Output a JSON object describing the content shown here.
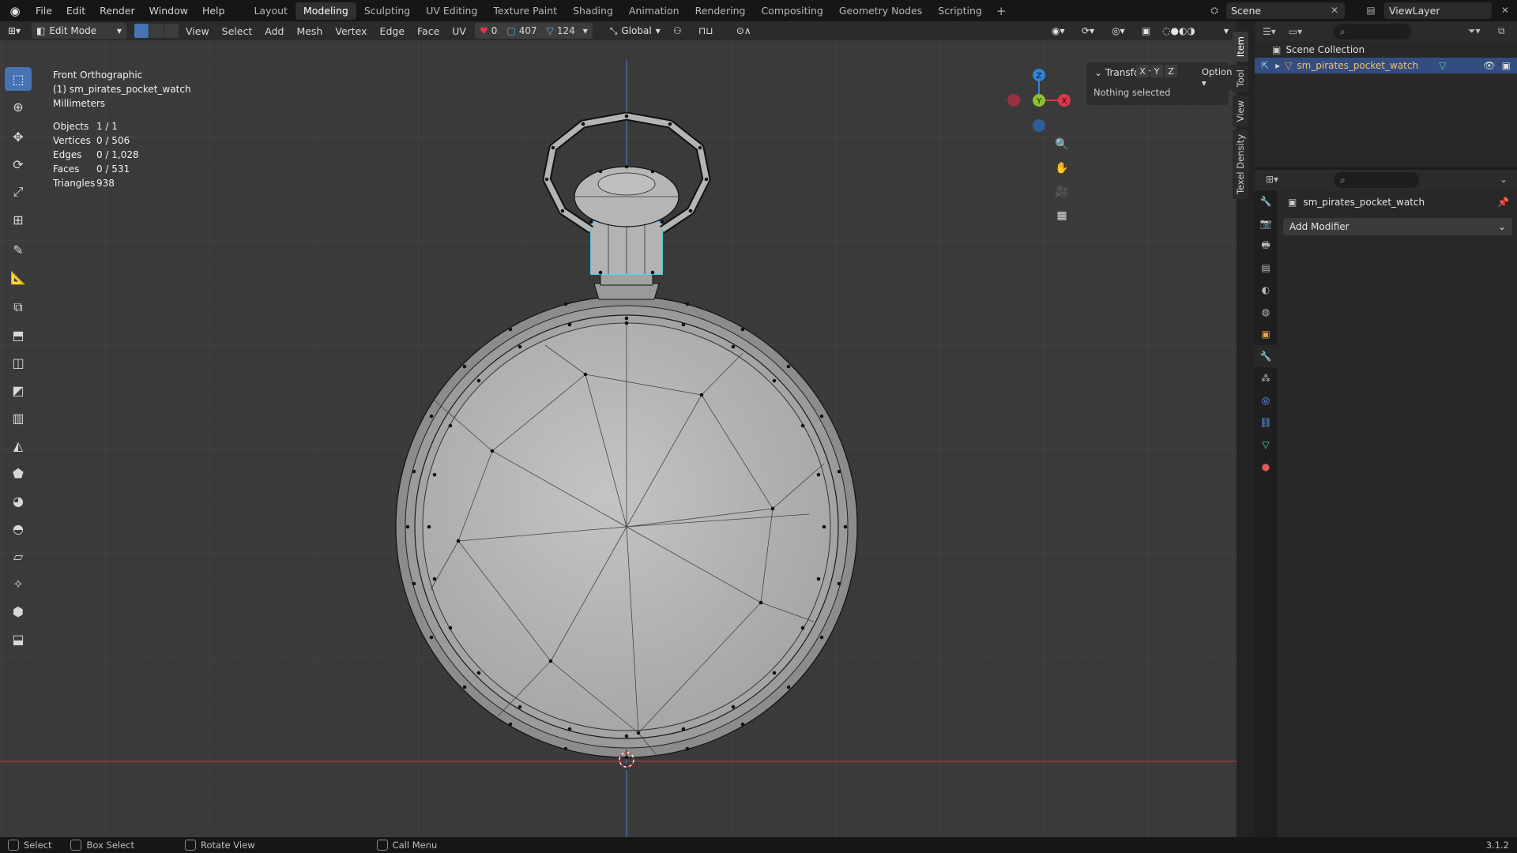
{
  "app": {
    "menus": [
      "File",
      "Edit",
      "Render",
      "Window",
      "Help"
    ],
    "workspaces": [
      "Layout",
      "Modeling",
      "Sculpting",
      "UV Editing",
      "Texture Paint",
      "Shading",
      "Animation",
      "Rendering",
      "Compositing",
      "Geometry Nodes",
      "Scripting"
    ],
    "active_workspace": "Modeling",
    "scene": "Scene",
    "view_layer": "ViewLayer",
    "version": "3.1.2"
  },
  "viewport_header": {
    "mode": "Edit Mode",
    "menus": [
      "View",
      "Select",
      "Add",
      "Mesh",
      "Vertex",
      "Edge",
      "Face",
      "UV"
    ],
    "stat_a": "0",
    "stat_b": "407",
    "stat_c": "124",
    "orientation": "Global",
    "options_label": "Options",
    "axis_x": "X",
    "axis_y": "Y",
    "axis_z": "Z"
  },
  "overlay": {
    "view_name": "Front Orthographic",
    "object_label": "(1) sm_pirates_pocket_watch",
    "units": "Millimeters",
    "stats": [
      {
        "k": "Objects",
        "v": "1 / 1"
      },
      {
        "k": "Vertices",
        "v": "0 / 506"
      },
      {
        "k": "Edges",
        "v": "0 / 1,028"
      },
      {
        "k": "Faces",
        "v": "0 / 531"
      },
      {
        "k": "Triangles",
        "v": "938"
      }
    ]
  },
  "npanel": {
    "header": "Transform",
    "body": "Nothing selected",
    "tabs": [
      "Item",
      "Tool",
      "View",
      "Texel Density"
    ]
  },
  "outliner": {
    "collection": "Scene Collection",
    "object": "sm_pirates_pocket_watch"
  },
  "properties": {
    "object": "sm_pirates_pocket_watch",
    "add_modifier": "Add Modifier"
  },
  "statusbar": {
    "select": "Select",
    "box_select": "Box Select",
    "rotate_view": "Rotate View",
    "call_menu": "Call Menu"
  },
  "colors": {
    "selection_blue": "#4772b3",
    "x_axis": "#e0364a",
    "y_axis": "#8bc12f",
    "z_axis": "#2f83d9",
    "highlight_cyan": "#5fd3e6"
  }
}
